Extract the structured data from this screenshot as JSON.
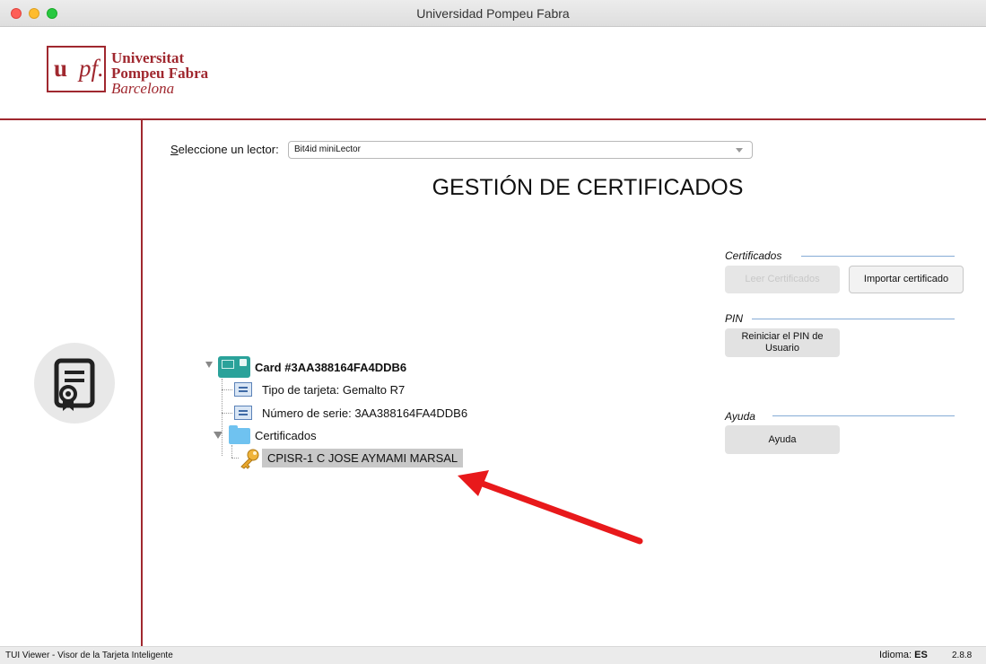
{
  "window": {
    "title": "Universidad Pompeu Fabra"
  },
  "logo": {
    "mark_u": "u",
    "mark_pf": "pf.",
    "line1": "Universitat",
    "line2": "Pompeu Fabra",
    "line3": "Barcelona"
  },
  "reader": {
    "label_first": "S",
    "label_rest": "eleccione un lector:",
    "selected": "Bit4id miniLector"
  },
  "main_title": "GESTIÓN DE CERTIFICADOS",
  "tree": {
    "card": "Card #3AA388164FA4DDB6",
    "card_type": "Tipo de tarjeta: Gemalto R7",
    "serial": "Número de serie: 3AA388164FA4DDB6",
    "certs_folder": "Certificados",
    "cert_item": "CPISR-1 C JOSE AYMAMI MARSAL"
  },
  "sections": {
    "certificados": {
      "label": "Certificados",
      "read_button": "Leer Certificados",
      "import_button": "Importar certificado"
    },
    "pin": {
      "label": "PIN",
      "reset_button_line1": "Reiniciar el PIN de",
      "reset_button_line2": "Usuario"
    },
    "ayuda": {
      "label": "Ayuda",
      "help_button": "Ayuda"
    }
  },
  "status": {
    "app_name": "TUI Viewer - Visor de la Tarjeta Inteligente",
    "language_label": "Idioma:",
    "language_value": "ES",
    "version": "2.8.8"
  },
  "colors": {
    "brand": "#a0282f",
    "accent_line": "#86acd6",
    "annotation_arrow": "#e8191b"
  }
}
